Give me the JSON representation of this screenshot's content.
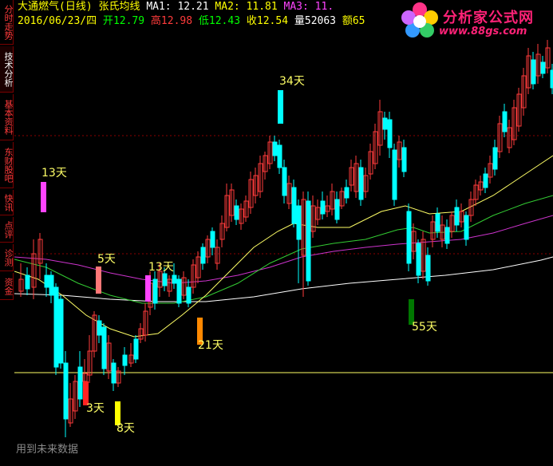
{
  "sidebar": {
    "tabs": [
      {
        "label": "分时走势",
        "active": false
      },
      {
        "label": "技术分析",
        "active": true
      },
      {
        "label": "基本资料",
        "active": false
      },
      {
        "label": "东财股吧",
        "active": false
      },
      {
        "label": "快讯",
        "active": false
      },
      {
        "label": "点评",
        "active": false
      },
      {
        "label": "诊测",
        "active": false
      },
      {
        "label": "资金",
        "active": false
      }
    ]
  },
  "header": {
    "title": "大通燃气(日线) 张氏均线",
    "ma1_label": "MA1:",
    "ma1_value": "12.21",
    "ma2_label": "MA2:",
    "ma2_value": "11.81",
    "ma3_label": "MA3:",
    "ma3_value": "11.",
    "date": "2016/06/23/四",
    "open_label": "开",
    "open_value": "12.79",
    "high_label": "高",
    "high_value": "12.98",
    "low_label": "低",
    "low_value": "12.43",
    "close_label": "收",
    "close_value": "12.54",
    "volume_label": "量",
    "volume_value": "52063",
    "amount_label": "额",
    "amount_value": "65"
  },
  "logo": {
    "name": "分析家公式网",
    "url": "www.88gs.com"
  },
  "footer_note": "用到未来数据",
  "colors": {
    "background": "#000000",
    "up": "#ff3b3b",
    "down": "#00ffff",
    "ma_white": "#ffffff",
    "ma_yellow": "#ffff66",
    "ma_green": "#33cc33",
    "ma_magenta": "#cc33cc",
    "baseline": "#ffff66",
    "grid": "#8b0000"
  },
  "chart_data": {
    "type": "candlestick",
    "markers": [
      {
        "label": "13天",
        "color": "#ff44ff"
      },
      {
        "label": "5天",
        "color": "#ff7777"
      },
      {
        "label": "13天",
        "color": "#ff44ff"
      },
      {
        "label": "34天",
        "color": "#00ffff"
      },
      {
        "label": "21天",
        "color": "#ff8800"
      },
      {
        "label": "3天",
        "color": "#ff2222"
      },
      {
        "label": "8天",
        "color": "#ffff00"
      },
      {
        "label": "55天",
        "color": "#007700"
      }
    ]
  }
}
